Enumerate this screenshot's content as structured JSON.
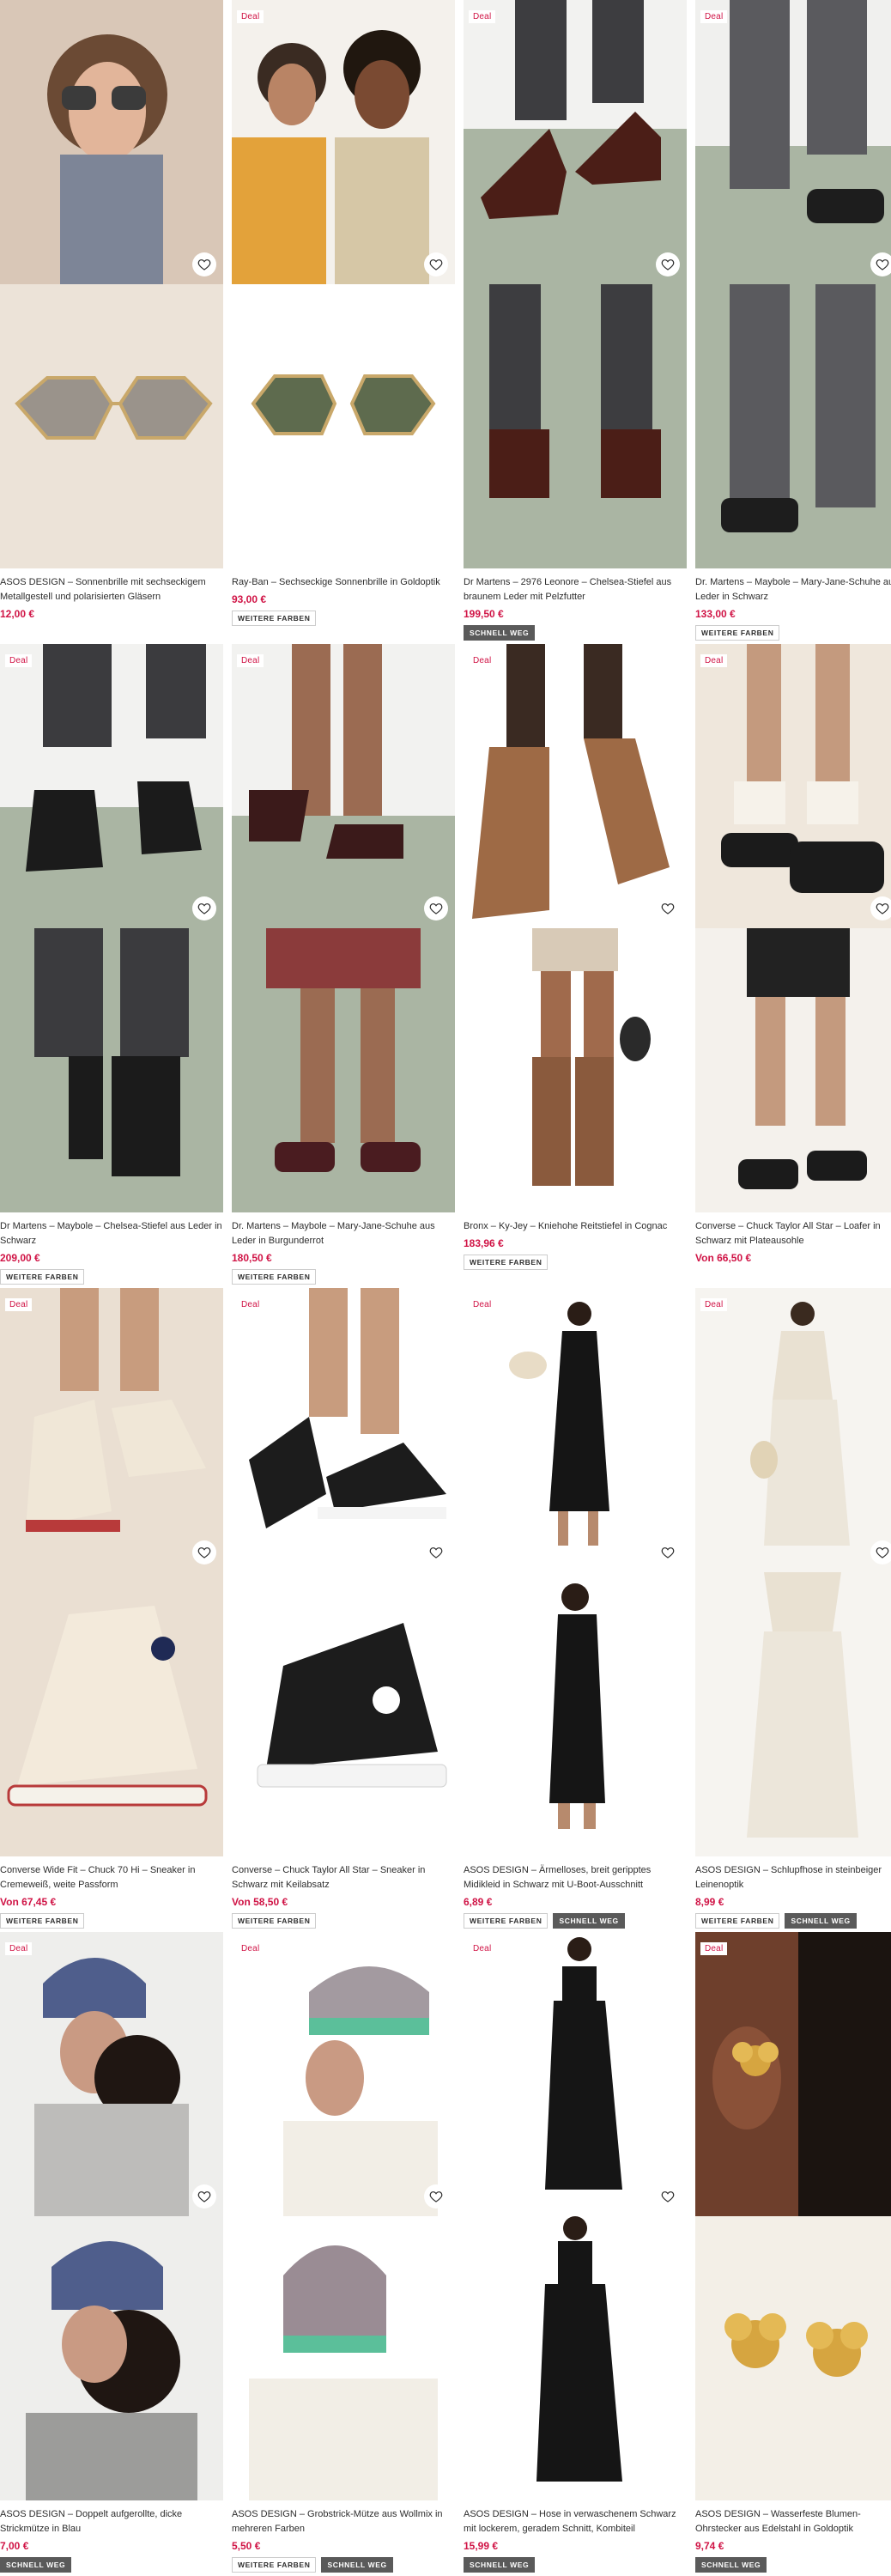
{
  "deal_label": "Deal",
  "tags": {
    "more_colors": "WEITERE FARBEN",
    "selling_fast": "SCHNELL WEG"
  },
  "products": [
    {
      "title": "ASOS DESIGN – Sonnenbrille mit sechseckigem Metallgestell und polarisierten Gläsern",
      "price": "12,00 €",
      "deal": false
    },
    {
      "title": "Ray-Ban – Sechseckige Sonnenbrille in Goldoptik",
      "price": "93,00 €",
      "deal": true
    },
    {
      "title": "Dr Martens – 2976 Leonore – Chelsea-Stiefel aus braunem Leder mit Pelzfutter",
      "price": "199,50 €",
      "deal": true
    },
    {
      "title": "Dr. Martens – Maybole – Mary-Jane-Schuhe aus Leder in Schwarz",
      "price": "133,00 €",
      "deal": true
    },
    {
      "title": "Dr Martens – Maybole – Chelsea-Stiefel aus Leder in Schwarz",
      "price": "209,00 €",
      "deal": true
    },
    {
      "title": "Dr. Martens – Maybole – Mary-Jane-Schuhe aus Leder in Burgunderrot",
      "price": "180,50 €",
      "deal": true
    },
    {
      "title": "Bronx – Ky-Jey – Kniehohe Reitstiefel in Cognac",
      "price": "183,96 €",
      "deal": true
    },
    {
      "title": "Converse – Chuck Taylor All Star – Loafer in Schwarz mit Plateausohle",
      "price": "Von 66,50 €",
      "deal": true
    },
    {
      "title": "Converse Wide Fit – Chuck 70 Hi – Sneaker in Cremeweiß, weite Passform",
      "price": "Von 67,45 €",
      "deal": true
    },
    {
      "title": "Converse – Chuck Taylor All Star – Sneaker in Schwarz mit Keilabsatz",
      "price": "Von 58,50 €",
      "deal": true
    },
    {
      "title": "ASOS DESIGN – Ärmelloses, breit geripptes Midikleid in Schwarz mit U-Boot-Ausschnitt",
      "price": "6,89 €",
      "deal": true
    },
    {
      "title": "ASOS DESIGN – Schlupfhose in steinbeiger Leinenoptik",
      "price": "8,99 €",
      "deal": true
    },
    {
      "title": "ASOS DESIGN – Doppelt aufgerollte, dicke Strickmütze in Blau",
      "price": "7,00 €",
      "deal": true
    },
    {
      "title": "ASOS DESIGN – Grobstrick-Mütze aus Wollmix in mehreren Farben",
      "price": "5,50 €",
      "deal": true
    },
    {
      "title": "ASOS DESIGN – Hose in verwaschenem Schwarz mit lockerem, geradem Schnitt, Kombiteil",
      "price": "15,99 €",
      "deal": true
    },
    {
      "title": "ASOS DESIGN – Wasserfeste Blumen-Ohrstecker aus Edelstahl in Goldoptik",
      "price": "9,74 €",
      "deal": true
    }
  ],
  "colors": {
    "price": "#d01345",
    "deal": "#d01345",
    "tag_dark": "#5a5a5a"
  },
  "icons": {
    "wishlist": "heart-icon"
  }
}
